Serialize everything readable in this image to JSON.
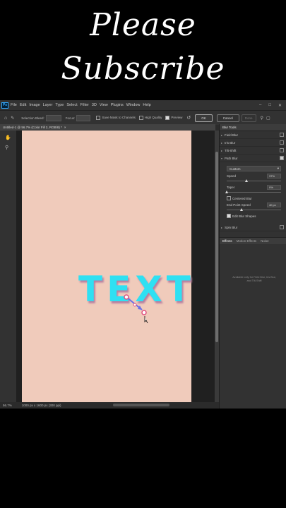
{
  "banner": {
    "line1": "Please",
    "line2": "Subscribe"
  },
  "app": {
    "logo": "Ps",
    "menu": [
      "File",
      "Edit",
      "Image",
      "Layer",
      "Type",
      "Select",
      "Filter",
      "3D",
      "View",
      "Plugins",
      "Window",
      "Help"
    ],
    "options": {
      "selection_bleed_label": "Selection Bleed:",
      "focus_label": "Focus:",
      "save_mask_label": "Save Mask to Channels",
      "high_quality_label": "High Quality",
      "preview_label": "Preview",
      "ok_label": "OK",
      "cancel_label": "Cancel",
      "more_label": "Done"
    },
    "doc_tab": "Untitled-1 @ 56.7% (Color Fill 2, RGB/8) *",
    "canvas_text": "TEXT",
    "status": {
      "zoom": "56.7%",
      "dims": "1000 px x 1600 px (300 ppi)"
    },
    "panel": {
      "title": "Blur Tools",
      "blurs": [
        {
          "label": "Field Blur",
          "checked": false
        },
        {
          "label": "Iris Blur",
          "checked": false
        },
        {
          "label": "Tilt-Shift",
          "checked": false
        },
        {
          "label": "Path Blur",
          "checked": true
        }
      ],
      "path_opts": {
        "mode": "Custom",
        "speed_label": "Speed",
        "speed_value": "37%",
        "speed_level": 0.37,
        "taper_label": "Taper",
        "taper_value": "0%",
        "taper_level": 0.0,
        "centered_label": "Centered Blur",
        "end_speed_label": "End Point Speed",
        "end_speed_value": "40 px",
        "end_speed_level": 0.27,
        "edit_shapes_label": "Edit Blur Shapes"
      },
      "spin": {
        "label": "Spin Blur",
        "checked": false
      },
      "tabs": [
        "Effects",
        "Motion Effects",
        "Noise"
      ],
      "message": "Available only for Field Blur, Iris Blur, and Tilt-Shift"
    }
  }
}
